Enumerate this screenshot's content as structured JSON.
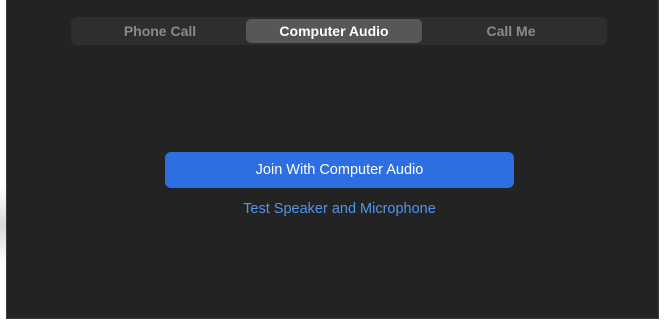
{
  "tabs": [
    {
      "label": "Phone Call",
      "selected": false
    },
    {
      "label": "Computer Audio",
      "selected": true
    },
    {
      "label": "Call Me",
      "selected": false
    }
  ],
  "main": {
    "join_button_label": "Join With Computer Audio",
    "test_link_label": "Test Speaker and Microphone"
  },
  "colors": {
    "background": "#232323",
    "tab_bar": "#2e2e2e",
    "selected_tab": "#575757",
    "primary_button": "#2d6fe0",
    "link": "#4f95f2"
  }
}
